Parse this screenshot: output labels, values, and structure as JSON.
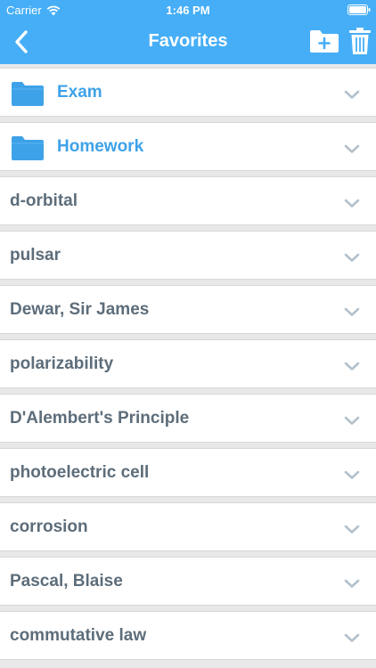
{
  "status_bar": {
    "carrier": "Carrier",
    "time": "1:46 PM"
  },
  "nav": {
    "title": "Favorites",
    "back_icon": "chevron-left-icon",
    "new_folder_icon": "folder-plus-icon",
    "trash_icon": "trash-icon"
  },
  "colors": {
    "accent": "#46aef7",
    "folder_label": "#3ea2e8",
    "item_label": "#5d6d7a",
    "chevron": "#b3c1cc",
    "background": "#e8e8e8"
  },
  "folders": [
    {
      "label": "Exam",
      "icon": "folder-icon"
    },
    {
      "label": "Homework",
      "icon": "folder-icon"
    }
  ],
  "items": [
    {
      "label": "d-orbital"
    },
    {
      "label": "pulsar"
    },
    {
      "label": "Dewar, Sir James"
    },
    {
      "label": "polarizability"
    },
    {
      "label": "D'Alembert's Principle"
    },
    {
      "label": "photoelectric cell"
    },
    {
      "label": "corrosion"
    },
    {
      "label": "Pascal, Blaise"
    },
    {
      "label": "commutative law"
    }
  ]
}
